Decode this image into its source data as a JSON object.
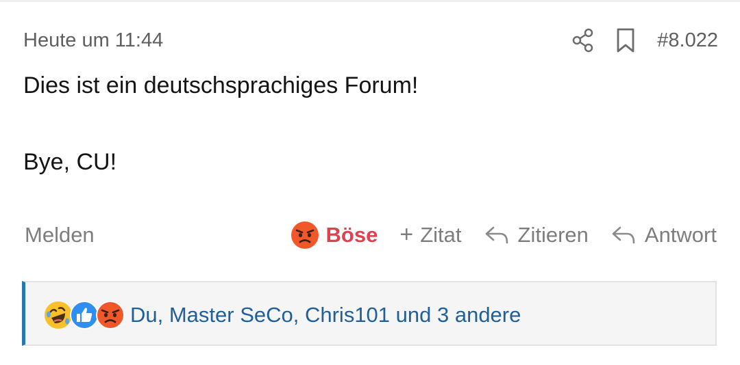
{
  "post": {
    "timestamp": "Heute um 11:44",
    "post_number": "#8.022",
    "body_line1": "Dies ist ein deutschsprachiges Forum!",
    "body_line2": "Bye, CU!"
  },
  "header_icons": [
    "share-icon",
    "bookmark-icon"
  ],
  "actions": {
    "report_label": "Melden",
    "reaction_label": "Böse",
    "reaction_icon": "angry-face-emoji",
    "multiquote_label": "Zitat",
    "quote_label": "Zitieren",
    "reply_label": "Antwort"
  },
  "reactions": {
    "icons": [
      "rolling-laughing-emoji",
      "thumbs-up-emoji",
      "angry-face-emoji"
    ],
    "users_text": "Du, Master SeCo, Chris101 und 3 andere"
  },
  "colors": {
    "link_blue": "#1f5f9a",
    "accent_border": "#2577b1",
    "angry_red": "#e0414f",
    "muted_text": "#7d7d7d"
  }
}
